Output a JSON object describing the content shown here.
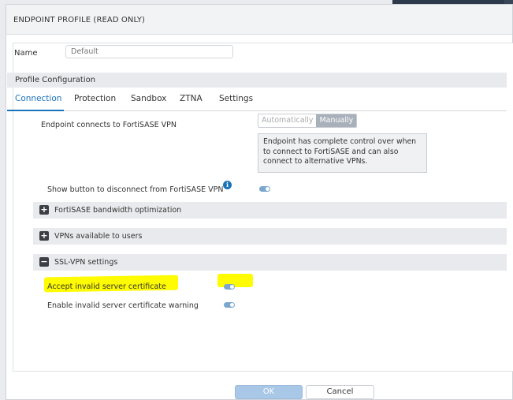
{
  "dialog": {
    "title": "ENDPOINT PROFILE (READ ONLY)"
  },
  "name_field": {
    "label": "Name",
    "placeholder": "Default"
  },
  "profile_config": {
    "title": "Profile Configuration"
  },
  "tabs": [
    {
      "label": "Connection",
      "active": true
    },
    {
      "label": "Protection",
      "active": false
    },
    {
      "label": "Sandbox",
      "active": false
    },
    {
      "label": "ZTNA",
      "active": false
    },
    {
      "label": "Settings",
      "active": false
    }
  ],
  "connection": {
    "vpn_label": "Endpoint connects to FortiSASE VPN",
    "mode_options": [
      "Automatically",
      "Manually"
    ],
    "mode_selected": "Manually",
    "mode_note": "Endpoint has complete control over when to connect to FortiSASE and can also connect to alternative VPNs.",
    "disconnect_label": "Show button to disconnect from FortiSASE VPN",
    "disconnect_enabled": true
  },
  "sections": [
    {
      "label": "FortiSASE bandwidth optimization",
      "expanded": false,
      "icon": "plus-icon"
    },
    {
      "label": "VPNs available to users",
      "expanded": false,
      "icon": "plus-icon"
    },
    {
      "label": "SSL-VPN settings",
      "expanded": true,
      "icon": "minus-icon"
    }
  ],
  "ssl_vpn": {
    "accept_invalid_label": "Accept invalid server certificate",
    "accept_invalid_enabled": true,
    "warning_label": "Enable invalid server certificate warning",
    "warning_enabled": true
  },
  "footer": {
    "ok_label": "OK",
    "cancel_label": "Cancel"
  },
  "colors": {
    "accent": "#1a73b8",
    "highlight": "#fffb00",
    "toggle_on": "#7aa6cf"
  }
}
